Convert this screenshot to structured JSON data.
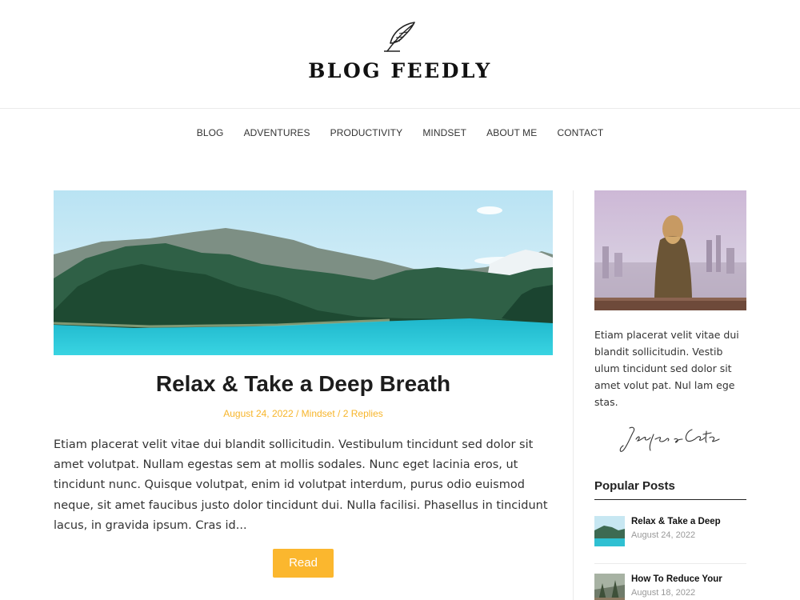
{
  "site": {
    "title": "BLOG FEEDLY",
    "logo_icon": "feather-icon"
  },
  "nav": {
    "items": [
      {
        "label": "BLOG"
      },
      {
        "label": "ADVENTURES"
      },
      {
        "label": "PRODUCTIVITY"
      },
      {
        "label": "MINDSET"
      },
      {
        "label": "ABOUT ME"
      },
      {
        "label": "CONTACT"
      }
    ]
  },
  "post": {
    "title": "Relax & Take a Deep Breath",
    "date": "August 24, 2022",
    "sep": " / ",
    "category": "Mindset",
    "replies": "2 Replies",
    "excerpt": "Etiam placerat velit vitae dui blandit sollicitudin. Vestibulum tincidunt sed dolor sit amet volutpat. Nullam egestas sem at mollis sodales. Nunc eget lacinia eros, ut tincidunt nunc. Quisque volutpat, enim id volutpat interdum, purus odio euismod neque, sit amet faucibus justo dolor tincidunt dui. Nulla facilisi. Phasellus in tincidunt lacus, in gravida ipsum. Cras id...",
    "read_label": "Read"
  },
  "sidebar": {
    "bio": "Etiam placerat velit vitae dui blandit sollicitudin. Vestib ulum tincidunt sed dolor sit amet volut pat. Nul lam ege stas.",
    "signature": "Jenifer Carter",
    "popular_heading": "Popular Posts",
    "popular": [
      {
        "title": "Relax & Take a Deep",
        "date": "August 24, 2022"
      },
      {
        "title": "How To Reduce Your",
        "date": "August 18, 2022"
      }
    ]
  },
  "colors": {
    "accent": "#fbb72e",
    "meta": "#f7b52a",
    "text": "#333333",
    "heading": "#1d1d1d"
  }
}
